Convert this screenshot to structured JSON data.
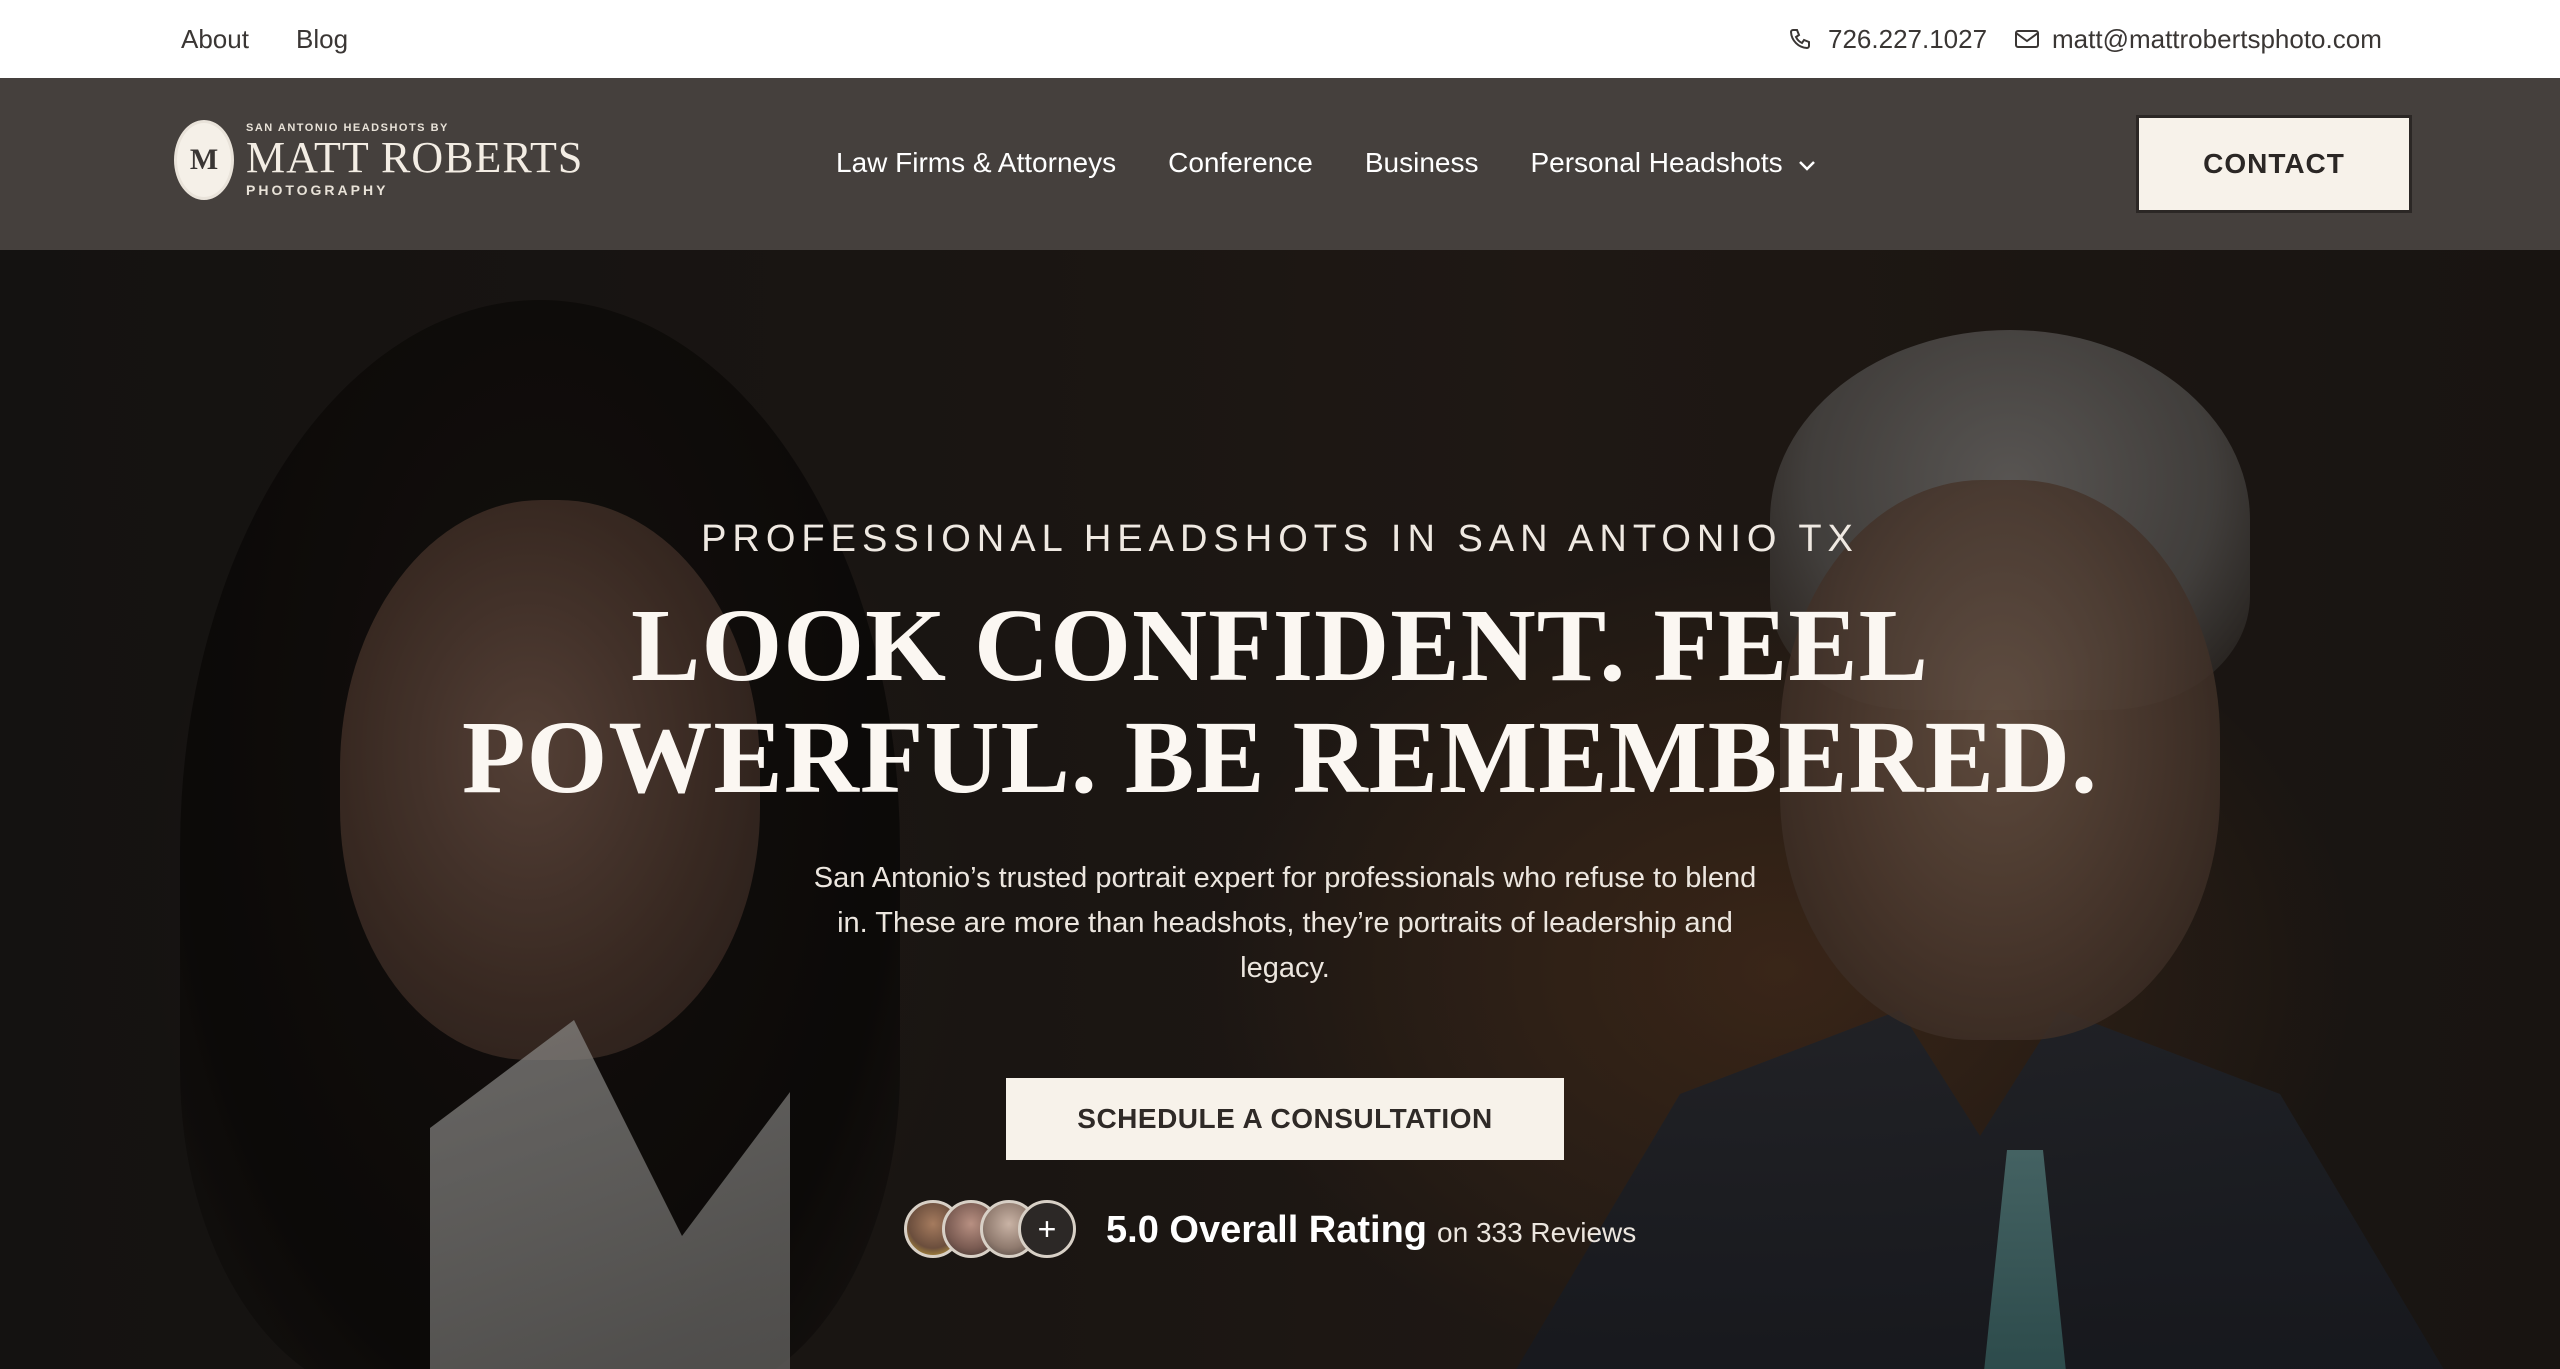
{
  "topbar": {
    "about": "About",
    "blog": "Blog",
    "phone": "726.227.1027",
    "email": "matt@mattrobertsphoto.com"
  },
  "header": {
    "logo": {
      "small": "SAN ANTONIO HEADSHOTS BY",
      "main": "MATT ROBERTS",
      "sub": "PHOTOGRAPHY",
      "monogram": "M"
    },
    "nav": [
      {
        "label": "Law Firms & Attorneys"
      },
      {
        "label": "Conference"
      },
      {
        "label": "Business"
      },
      {
        "label": "Personal Headshots"
      }
    ],
    "contact": "CONTACT"
  },
  "hero": {
    "eyebrow": "PROFESSIONAL HEADSHOTS IN SAN ANTONIO TX",
    "headline_line1": "LOOK CONFIDENT. FEEL",
    "headline_line2": "POWERFUL. BE REMEMBERED.",
    "subtext": "San Antonio’s trusted portrait expert for professionals who refuse to blend in. These are more than headshots, they’re portraits of leadership and legacy.",
    "cta": "SCHEDULE A CONSULTATION",
    "rating_main": "5.0 Overall Rating",
    "rating_sub": "on 333 Reviews",
    "avatar_plus": "+"
  }
}
